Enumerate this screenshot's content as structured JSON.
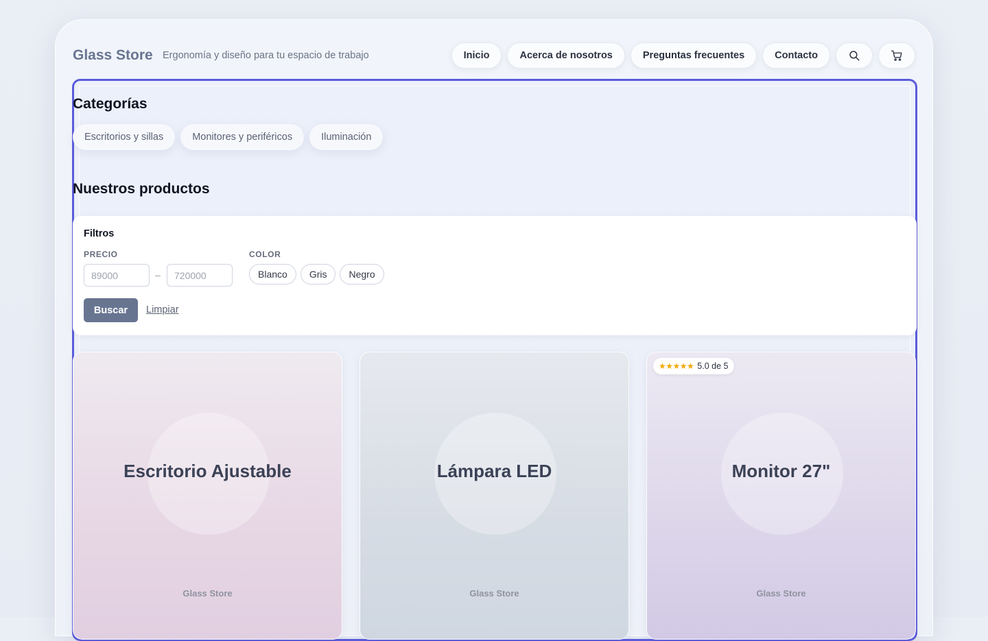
{
  "header": {
    "brand": "Glass Store",
    "tagline": "Ergonomía y diseño para tu espacio de trabajo",
    "nav": [
      "Inicio",
      "Acerca de nosotros",
      "Preguntas frecuentes",
      "Contacto"
    ],
    "icons": [
      "search-icon",
      "cart-icon"
    ]
  },
  "categories": {
    "title": "Categorías",
    "items": [
      "Escritorios y sillas",
      "Monitores y periféricos",
      "Iluminación"
    ]
  },
  "products_section": {
    "title": "Nuestros productos"
  },
  "filters": {
    "title": "Filtros",
    "price_label": "PRECIO",
    "price_min_placeholder": "89000",
    "price_max_placeholder": "720000",
    "separator": "–",
    "color_label": "COLOR",
    "colors": [
      "Blanco",
      "Gris",
      "Negro"
    ],
    "search_label": "Buscar",
    "clear_label": "Limpiar"
  },
  "products": [
    {
      "name": "Escritorio Ajustable",
      "brand": "Glass Store"
    },
    {
      "name": "Lámpara LED",
      "brand": "Glass Store"
    },
    {
      "name": "Monitor 27\"",
      "brand": "Glass Store",
      "rating_text": "5.0 de 5",
      "stars": "★★★★★",
      "rating": 5.0
    }
  ],
  "colors": {
    "accent": "#687591",
    "focus_border": "#5b5bdc",
    "star": "#f2a900"
  }
}
